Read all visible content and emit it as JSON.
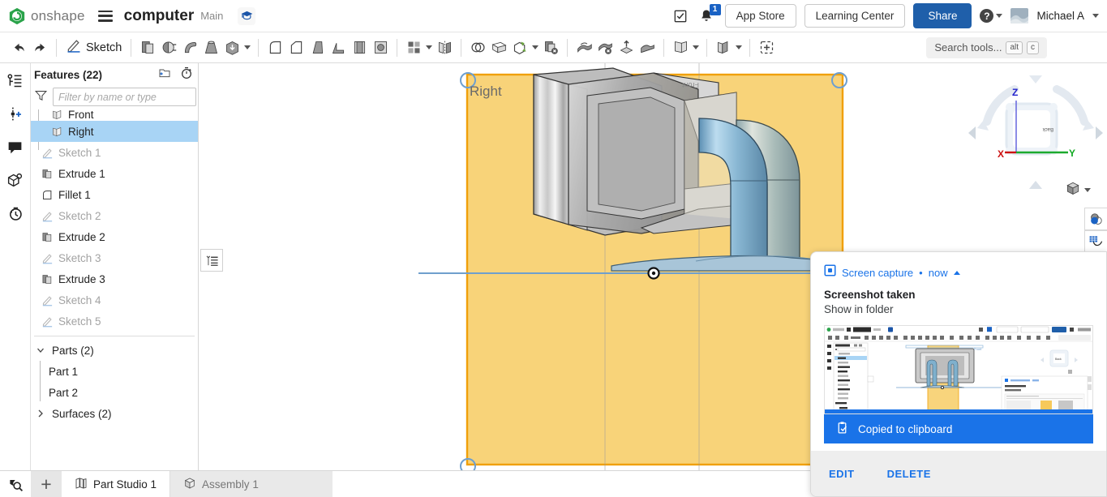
{
  "header": {
    "brand": "onshape",
    "brand_icon": "onshape-logo-icon",
    "menu_icon": "hamburger-menu-icon",
    "document_title": "computer",
    "branch": "Main",
    "graduation_icon": "graduation-cap-icon",
    "check_icon": "check-circle-icon",
    "bell_icon": "notification-bell-icon",
    "bell_badge": "1",
    "app_store": "App Store",
    "learning_center": "Learning Center",
    "share": "Share",
    "help_icon": "help-question-icon",
    "user_name": "Michael A",
    "avatar_icon": "user-avatar",
    "accent_blue": "#1f5faa"
  },
  "toolbar": {
    "undo_icon": "undo-arrow-icon",
    "redo_icon": "redo-arrow-icon",
    "sketch_label": "Sketch",
    "sketch_icon": "sketch-pencil-icon",
    "tools": [
      {
        "name": "extrude-icon"
      },
      {
        "name": "revolve-icon"
      },
      {
        "name": "sweep-icon"
      },
      {
        "name": "loft-icon"
      },
      {
        "name": "thicken-icon"
      },
      {
        "name": "fillet-icon"
      },
      {
        "name": "chamfer-icon"
      },
      {
        "name": "draft-icon"
      },
      {
        "name": "rib-icon"
      },
      {
        "name": "shell-icon"
      },
      {
        "name": "hole-icon"
      },
      {
        "name": "pattern-icon"
      },
      {
        "name": "mirror-icon"
      },
      {
        "name": "boolean-icon"
      },
      {
        "name": "plane-icon"
      },
      {
        "name": "transform-icon"
      },
      {
        "name": "delete-part-icon"
      },
      {
        "name": "split-icon"
      },
      {
        "name": "delete-face-icon"
      },
      {
        "name": "move-face-icon"
      },
      {
        "name": "replace-face-icon"
      },
      {
        "name": "surface-icon"
      },
      {
        "name": "sheet-metal-icon"
      },
      {
        "name": "add-feature-icon"
      }
    ],
    "search_placeholder": "Search tools...",
    "search_shortcut_alt": "alt",
    "search_shortcut_key": "c"
  },
  "rail": {
    "items": [
      {
        "name": "feature-list-icon"
      },
      {
        "name": "insert-point-icon"
      },
      {
        "name": "comments-icon"
      },
      {
        "name": "versions-cube-icon"
      },
      {
        "name": "history-clock-icon"
      }
    ]
  },
  "feature_tree": {
    "title": "Features (22)",
    "new_folder_icon": "new-folder-icon",
    "rollback_icon": "rollback-timer-icon",
    "filter_icon": "filter-funnel-icon",
    "filter_placeholder": "Filter by name or type",
    "rows": [
      {
        "label": "Front",
        "icon": "plane-icon",
        "state": "partial",
        "indent": 1
      },
      {
        "label": "Right",
        "icon": "plane-icon",
        "state": "selected",
        "indent": 1
      },
      {
        "label": "Sketch 1",
        "icon": "sketch-icon",
        "state": "dim",
        "indent": 0
      },
      {
        "label": "Extrude 1",
        "icon": "extrude-icon",
        "state": "normal",
        "indent": 0
      },
      {
        "label": "Fillet 1",
        "icon": "fillet-icon",
        "state": "normal",
        "indent": 0
      },
      {
        "label": "Sketch 2",
        "icon": "sketch-icon",
        "state": "dim",
        "indent": 0
      },
      {
        "label": "Extrude 2",
        "icon": "extrude-icon",
        "state": "normal",
        "indent": 0
      },
      {
        "label": "Sketch 3",
        "icon": "sketch-icon",
        "state": "dim",
        "indent": 0
      },
      {
        "label": "Extrude 3",
        "icon": "extrude-icon",
        "state": "normal",
        "indent": 0
      },
      {
        "label": "Sketch 4",
        "icon": "sketch-icon",
        "state": "dim",
        "indent": 0
      },
      {
        "label": "Sketch 5",
        "icon": "sketch-icon",
        "state": "dim",
        "indent": 0
      }
    ],
    "parts_group": "Parts (2)",
    "parts": [
      "Part 1",
      "Part 2"
    ],
    "surfaces_group": "Surfaces (2)",
    "expanded_icon": "chevron-down-icon",
    "collapsed_icon": "chevron-right-icon",
    "list_toggle_icon": "list-view-toggle-icon"
  },
  "viewport": {
    "plane_label": "Right",
    "plane_label_secondary": "Front",
    "plane_fill": "#f6c95b",
    "plane_border": "#f2a20c",
    "origin_marker": "origin-point-icon"
  },
  "viewcube": {
    "face_label": "Right",
    "back_label": "Back",
    "axis_z": "Z",
    "axis_x": "X",
    "axis_y": "Y",
    "color_z": "#2222cc",
    "color_x": "#cc1111",
    "color_y": "#11aa22",
    "display_mode_icon": "display-style-cube-icon"
  },
  "right_tools": [
    {
      "name": "appearance-icon"
    },
    {
      "name": "grid-snap-icon"
    }
  ],
  "bottom_bar": {
    "search_icon": "tab-search-icon",
    "add_icon": "add-tab-icon",
    "add_label": "+",
    "tabs": [
      {
        "label": "Part Studio 1",
        "icon": "part-studio-icon",
        "active": true
      },
      {
        "label": "Assembly 1",
        "icon": "assembly-icon",
        "active": false
      }
    ]
  },
  "notification": {
    "app_icon": "screen-capture-icon",
    "app_name": "Screen capture",
    "separator": "•",
    "time": "now",
    "collapse_icon": "chevron-up-icon",
    "title": "Screenshot taken",
    "subtitle": "Show in folder",
    "thumbnail_name": "screenshot-thumbnail",
    "clipboard_icon": "clipboard-check-icon",
    "clipboard_text": "Copied to clipboard",
    "clipboard_bg": "#1a73e8",
    "actions": [
      "EDIT",
      "DELETE"
    ]
  }
}
